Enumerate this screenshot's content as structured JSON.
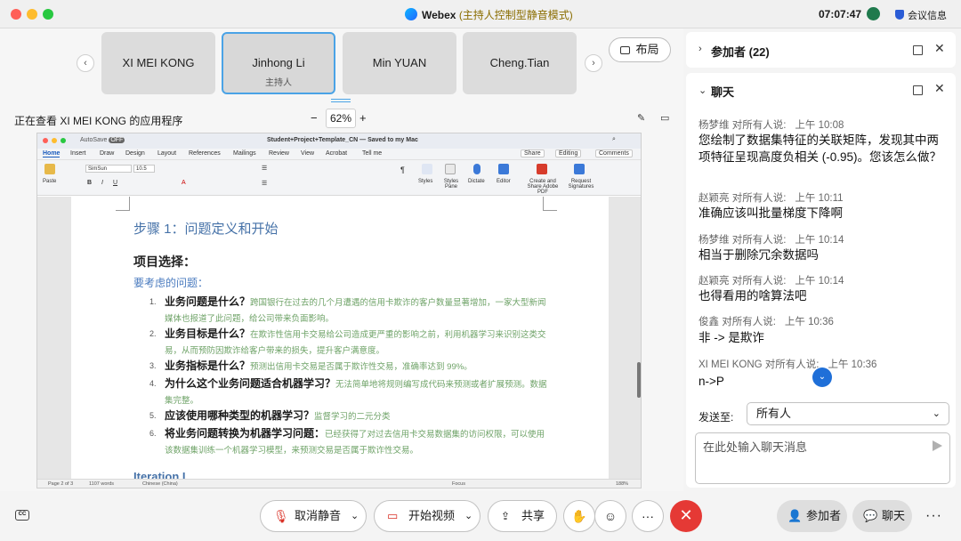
{
  "window": {
    "brand": "Webex",
    "mode": "(主持人控制型静音模式)",
    "clock": "07:07:47",
    "meeting_info": "会议信息"
  },
  "stage": {
    "participants": [
      {
        "name": "XI MEI KONG",
        "role": ""
      },
      {
        "name": "Jinhong Li",
        "role": "主持人"
      },
      {
        "name": "Min YUAN",
        "role": ""
      },
      {
        "name": "Cheng.Tian",
        "role": ""
      }
    ],
    "layout_label": "布局",
    "viewing_label": "正在查看 XI MEI KONG 的应用程序",
    "zoom": "62%",
    "zoom_minus": "−",
    "zoom_plus": "+"
  },
  "word": {
    "autosave": "AutoSave",
    "autosave_state": "OFF",
    "filename": "Student+Project+Template_CN — Saved to my Mac",
    "tabs": [
      "Home",
      "Insert",
      "Draw",
      "Design",
      "Layout",
      "References",
      "Mailings",
      "Review",
      "View",
      "Acrobat",
      "Tell me"
    ],
    "share_label": "Share",
    "editing_label": "Editing",
    "comments_label": "Comments",
    "font_name": "SimSun",
    "font_size": "10.5",
    "paste_label": "Paste",
    "styles_label": "Styles",
    "styles_pane_label": "Styles Pane",
    "dictate_label": "Dictate",
    "editor_label": "Editor",
    "create_share_label": "Create and Share Adobe PDF",
    "request_sig_label": "Request Signatures",
    "heading1": "步骤 1：问题定义和开始",
    "heading2": "项目选择：",
    "heading3": "要考虑的问题：",
    "items": [
      {
        "num": "1.",
        "q": "业务问题是什么？",
        "a": "跨国银行在过去的几个月遭遇的信用卡欺诈的客户数量显著增加，一家大型新闻媒体也报道了此问题，给公司带来负面影响。"
      },
      {
        "num": "2.",
        "q": "业务目标是什么？",
        "a": "在欺诈性信用卡交易给公司造成更严重的影响之前，利用机器学习来识别这类交易，从而预防因欺诈给客户带来的损失，提升客户满意度。"
      },
      {
        "num": "3.",
        "q": "业务指标是什么？",
        "a": "预测出信用卡交易是否属于欺诈性交易，准确率达到 99%。"
      },
      {
        "num": "4.",
        "q": "为什么这个业务问题适合机器学习？",
        "a": "无法简单地将规则编写成代码来预测或者扩展预测。数据集完整。"
      },
      {
        "num": "5.",
        "q": "应该使用哪种类型的机器学习？",
        "a": "监督学习的二元分类"
      },
      {
        "num": "6.",
        "q": "将业务问题转换为机器学习问题：",
        "a": "已经获得了对过去信用卡交易数据集的访问权限，可以使用该数据集训练一个机器学习模型，来预测交易是否属于欺诈性交易。"
      }
    ],
    "next_heading": "Iteration I",
    "status_page": "Page 2 of 3",
    "status_words": "1107 words",
    "status_lang": "Chinese (China)",
    "status_focus": "Focus",
    "status_zoom": "188%"
  },
  "toolbar": {
    "unmute_label": "取消静音",
    "video_label": "开始视频",
    "share_label": "共享",
    "participants_label": "参加者",
    "chat_label": "聊天",
    "cc_label": "CC"
  },
  "panel": {
    "participants_title": "参加者 (22)",
    "chat_title": "聊天",
    "messages": [
      {
        "sender": "杨梦维 对所有人说:",
        "time": "上午 10:08",
        "text": "您绘制了数据集特征的关联矩阵，发现其中两项特征呈现高度负相关 (-0.95)。您该怎么做？"
      },
      {
        "sender": "赵颖亮 对所有人说:",
        "time": "上午 10:11",
        "text": "准确应该叫批量梯度下降啊"
      },
      {
        "sender": "杨梦维 对所有人说:",
        "time": "上午 10:14",
        "text": "相当于删除冗余数据吗"
      },
      {
        "sender": "赵颖亮 对所有人说:",
        "time": "上午 10:14",
        "text": "也得看用的啥算法吧"
      },
      {
        "sender": "俊鑫 对所有人说:",
        "time": "上午 10:36",
        "text": "非 -> 是欺诈"
      },
      {
        "sender": "XI MEI KONG 对所有人说:",
        "time": "上午 10:36",
        "text": "n->P"
      }
    ],
    "send_to_label": "发送至:",
    "send_to_value": "所有人",
    "input_placeholder": "在此处输入聊天消息"
  }
}
